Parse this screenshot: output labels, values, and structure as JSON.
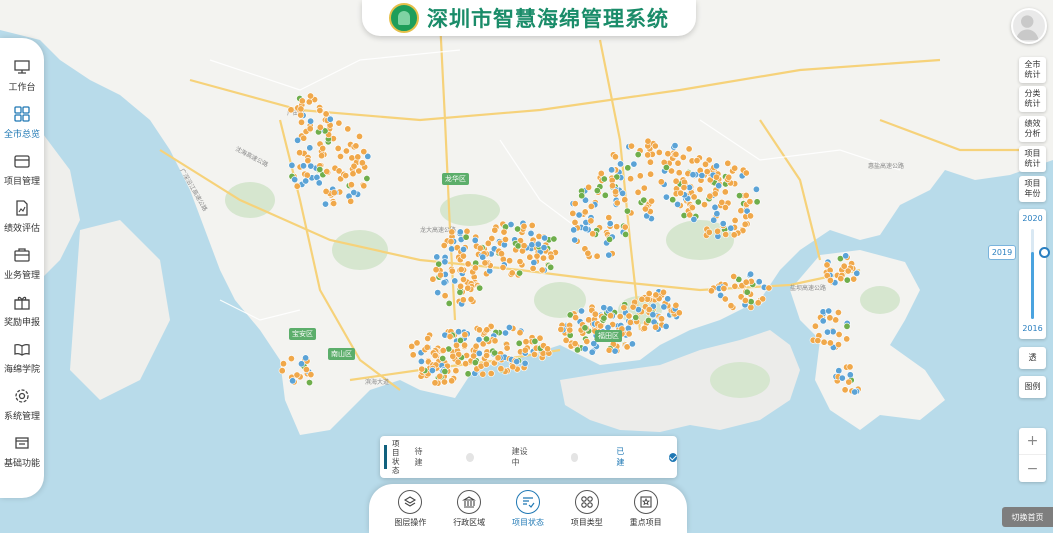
{
  "header": {
    "title": "深圳市智慧海绵管理系统"
  },
  "sidebar": {
    "items": [
      {
        "label": "工作台",
        "icon": "monitor-icon",
        "active": false
      },
      {
        "label": "全市总览",
        "icon": "grid-icon",
        "active": true
      },
      {
        "label": "项目管理",
        "icon": "wallet-icon",
        "active": false
      },
      {
        "label": "绩效评估",
        "icon": "report-icon",
        "active": false
      },
      {
        "label": "业务管理",
        "icon": "briefcase-icon",
        "active": false
      },
      {
        "label": "奖励申报",
        "icon": "gift-icon",
        "active": false
      },
      {
        "label": "海绵学院",
        "icon": "book-icon",
        "active": false
      },
      {
        "label": "系统管理",
        "icon": "gear-icon",
        "active": false
      },
      {
        "label": "基础功能",
        "icon": "calendar-icon",
        "active": false
      }
    ]
  },
  "right_panel": {
    "buttons": [
      "全市统计",
      "分类统计",
      "绩效分析",
      "项目统计",
      "项目年份"
    ],
    "year_slider": {
      "max": "2020",
      "min": "2016",
      "current": "2019",
      "fraction": 0.75
    },
    "transparency_label": "透",
    "legend_label": "图例",
    "zoom_in": "+",
    "zoom_out": "−",
    "switch_home": "切换首页"
  },
  "status_legend": {
    "title": "项目状态",
    "items": [
      {
        "label": "待建",
        "checked": false
      },
      {
        "label": "建设中",
        "checked": false
      },
      {
        "label": "已建",
        "checked": true
      }
    ]
  },
  "toolbar": {
    "items": [
      {
        "label": "图层操作",
        "icon": "layers-icon",
        "active": false
      },
      {
        "label": "行政区域",
        "icon": "government-icon",
        "active": false
      },
      {
        "label": "项目状态",
        "icon": "list-check-icon",
        "active": true
      },
      {
        "label": "项目类型",
        "icon": "category-icon",
        "active": false
      },
      {
        "label": "重点项目",
        "icon": "star-icon",
        "active": false
      }
    ]
  },
  "map": {
    "districts": [
      {
        "label": "宝安区"
      },
      {
        "label": "南山区"
      },
      {
        "label": "龙华区"
      },
      {
        "label": "福田区"
      }
    ],
    "road_labels": [
      "沈海高速公路",
      "广深沿江高速公路",
      "滨海大道",
      "惠盐高速公路",
      "龙大高速公路",
      "盐坝高速公路",
      "广田路"
    ],
    "colors": {
      "built": "#f0a84a",
      "building": "#5ba3d6",
      "pending": "#6fae4c",
      "land": "#f5f5f2",
      "sea": "#b8dbea"
    }
  }
}
